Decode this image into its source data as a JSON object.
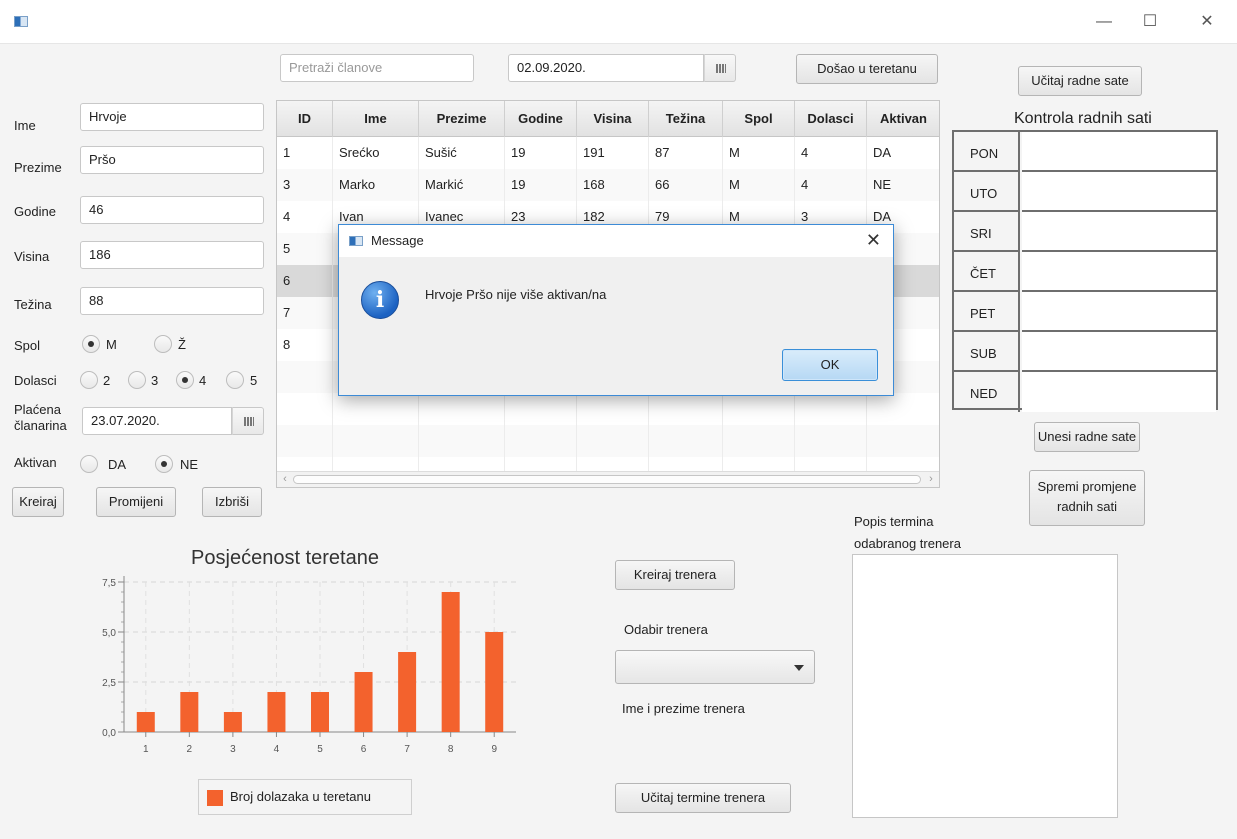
{
  "window": {
    "minimize": "—",
    "maximize": "☐",
    "close": "✕"
  },
  "form": {
    "ime_label": "Ime",
    "ime_value": "Hrvoje",
    "prezime_label": "Prezime",
    "prezime_value": "Pršo",
    "godine_label": "Godine",
    "godine_value": "46",
    "visina_label": "Visina",
    "visina_value": "186",
    "tezina_label": "Težina",
    "tezina_value": "88",
    "spol_label": "Spol",
    "spol_options": [
      "M",
      "Ž"
    ],
    "spol_selected": "M",
    "dolasci_label": "Dolasci",
    "dolasci_options": [
      "2",
      "3",
      "4",
      "5"
    ],
    "dolasci_selected": "4",
    "placena_label_1": "Plaćena",
    "placena_label_2": "članarina",
    "placena_value": "23.07.2020.",
    "aktivan_label": "Aktivan",
    "aktivan_options": [
      "DA",
      "NE"
    ],
    "aktivan_selected": "NE",
    "kreiraj": "Kreiraj",
    "promijeni": "Promijeni",
    "izbrisi": "Izbriši"
  },
  "top": {
    "search_placeholder": "Pretraži članove",
    "date_value": "02.09.2020.",
    "dosao_button": "Došao u teretanu"
  },
  "table": {
    "columns": [
      "ID",
      "Ime",
      "Prezime",
      "Godine",
      "Visina",
      "Težina",
      "Spol",
      "Dolasci",
      "Aktivan"
    ],
    "rows": [
      [
        "1",
        "Srećko",
        "Sušić",
        "19",
        "191",
        "87",
        "M",
        "4",
        "DA"
      ],
      [
        "3",
        "Marko",
        "Markić",
        "19",
        "168",
        "66",
        "M",
        "4",
        "NE"
      ],
      [
        "4",
        "Ivan",
        "Ivanec",
        "23",
        "182",
        "79",
        "M",
        "3",
        "DA"
      ],
      [
        "5",
        "",
        "",
        "",
        "",
        "",
        "",
        "",
        ""
      ],
      [
        "6",
        "",
        "",
        "",
        "",
        "",
        "",
        "",
        ""
      ],
      [
        "7",
        "",
        "",
        "",
        "",
        "",
        "",
        "",
        ""
      ],
      [
        "8",
        "",
        "",
        "",
        "",
        "",
        "",
        "",
        ""
      ]
    ],
    "selected_row": 4
  },
  "hours": {
    "load_button": "Učitaj radne sate",
    "title": "Kontrola radnih sati",
    "days": [
      "PON",
      "UTO",
      "SRI",
      "ČET",
      "PET",
      "SUB",
      "NED"
    ],
    "enter_button": "Unesi radne sate",
    "save_button_1": "Spremi promjene",
    "save_button_2": "radnih sati"
  },
  "trainer": {
    "create_button": "Kreiraj trenera",
    "select_label": "Odabir trenera",
    "name_label": "Ime i prezime trenera",
    "load_button": "Učitaj termine trenera",
    "list_label_1": "Popis termina",
    "list_label_2": "odabranog trenera"
  },
  "chart_data": {
    "type": "bar",
    "title": "Posjećenost teretane",
    "categories": [
      "1",
      "2",
      "3",
      "4",
      "5",
      "6",
      "7",
      "8",
      "9"
    ],
    "series": [
      {
        "name": "Broj dolazaka u teretanu",
        "values": [
          1,
          2,
          1,
          2,
          2,
          3,
          4,
          7,
          5
        ],
        "color": "#f3622d"
      }
    ],
    "ylim": [
      0,
      7.5
    ],
    "yticks": [
      "0,0",
      "2,5",
      "5,0",
      "7,5"
    ],
    "grid": true,
    "legend": "bottom"
  },
  "dialog": {
    "title": "Message",
    "message": "Hrvoje Pršo nije više aktivan/na",
    "ok": "OK",
    "close": "✕",
    "icon": "info-icon"
  }
}
